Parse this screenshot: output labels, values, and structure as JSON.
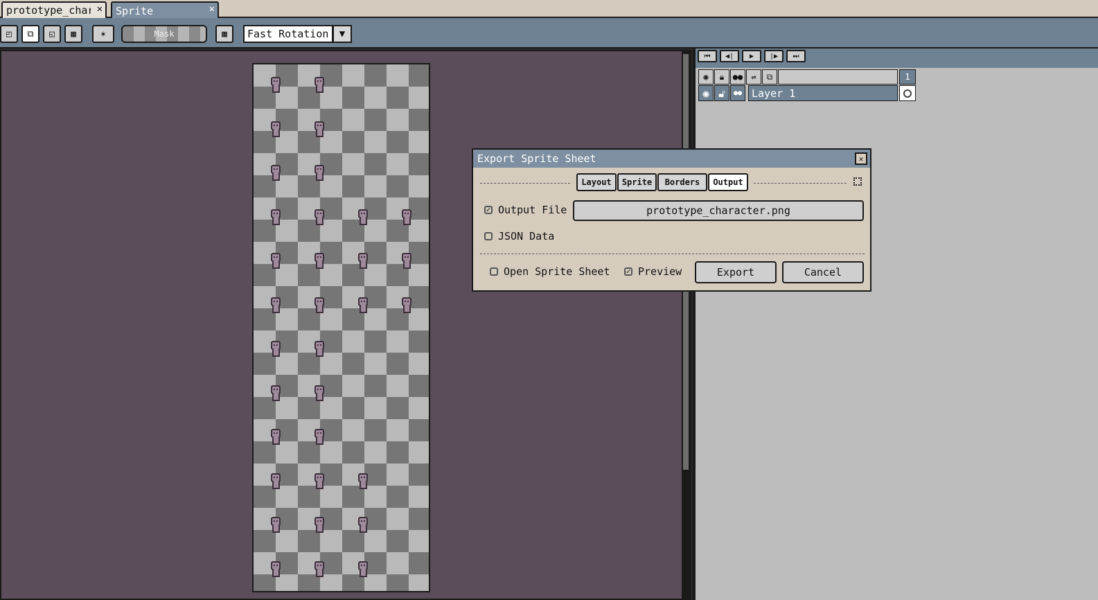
{
  "tabs": [
    {
      "label": "prototype_character",
      "close": "✕"
    },
    {
      "label": "Sprite",
      "close": "✕"
    }
  ],
  "toolbar": {
    "mask_label": "Mask",
    "rotation_value": "Fast Rotation",
    "dropdown_arrow": "▼"
  },
  "timeline": {
    "playback": [
      "⏮",
      "◀|",
      "▶",
      "|▶",
      "⏭"
    ],
    "frame_number": "1",
    "layer_name": "Layer 1"
  },
  "dialog": {
    "title": "Export Sprite Sheet",
    "close": "✕",
    "tabs": [
      "Layout",
      "Sprite",
      "Borders",
      "Output"
    ],
    "active_tab": "Output",
    "output_file_label": "Output File",
    "output_file_checked": true,
    "output_file_value": "prototype_character.png",
    "json_data_label": "JSON Data",
    "json_data_checked": false,
    "open_sheet_label": "Open Sprite Sheet",
    "open_sheet_checked": false,
    "preview_label": "Preview",
    "preview_checked": true,
    "export_label": "Export",
    "cancel_label": "Cancel"
  }
}
